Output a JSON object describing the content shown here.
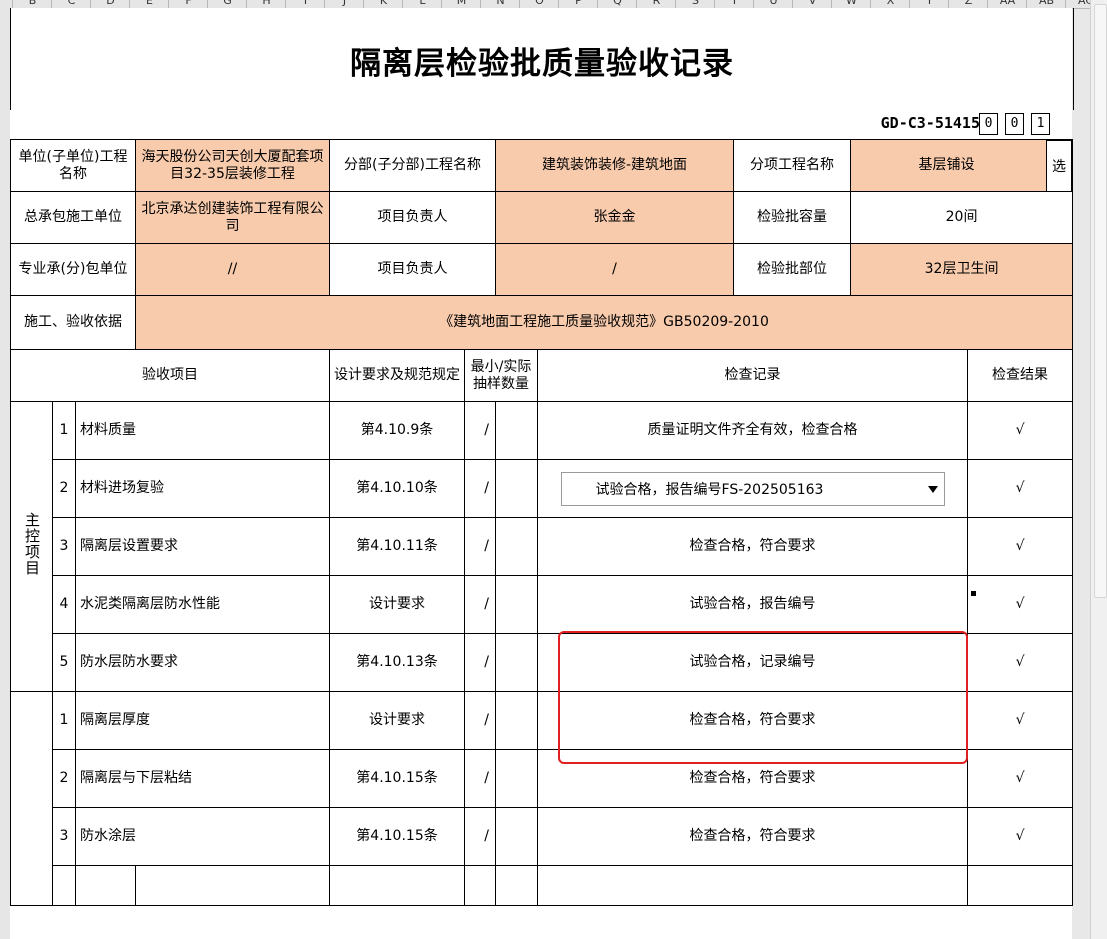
{
  "column_headers": [
    "B",
    "C",
    "D",
    "E",
    "F",
    "G",
    "H",
    "I",
    "J",
    "K",
    "L",
    "M",
    "N",
    "O",
    "P",
    "Q",
    "R",
    "S",
    "T",
    "U",
    "V",
    "W",
    "X",
    "Y",
    "Z",
    "AA",
    "AB",
    "AC"
  ],
  "title": "隔离层检验批质量验收记录",
  "doc_code": "GD-C3-51415",
  "code_digits": [
    "0",
    "0",
    "1"
  ],
  "header": {
    "unit_label": "单位(子单位)工程名称",
    "unit_value": "海天股份公司天创大厦配套项目32-35层装修工程",
    "division_label": "分部(子分部)工程名称",
    "division_value": "建筑装饰装修-建筑地面",
    "subitem_label": "分项工程名称",
    "subitem_value": "基层铺设",
    "select_label": "选",
    "contractor_label": "总承包施工单位",
    "contractor_value": "北京承达创建装饰工程有限公司",
    "pm_label": "项目负责人",
    "pm_value": "张金金",
    "capacity_label": "检验批容量",
    "capacity_value": "20间",
    "sub_label": "专业承(分)包单位",
    "sub_value": "//",
    "pm2_label": "项目负责人",
    "pm2_value": "/",
    "location_label": "检验批部位",
    "location_value": "32层卫生间",
    "basis_label": "施工、验收依据",
    "basis_value": "《建筑地面工程施工质量验收规范》GB50209-2010"
  },
  "columns": {
    "item": "验收项目",
    "design": "设计要求及规范规定",
    "sampling": "最小/实际抽样数量",
    "record": "检查记录",
    "result": "检查结果"
  },
  "main_group_label": "主控项目",
  "main_items": [
    {
      "no": "1",
      "name": "材料质量",
      "spec": "第4.10.9条",
      "sample": "/",
      "record": "质量证明文件齐全有效，检查合格",
      "result": "√"
    },
    {
      "no": "2",
      "name": "材料进场复验",
      "spec": "第4.10.10条",
      "sample": "/",
      "record": "试验合格，报告编号FS-202505163",
      "result": "√"
    },
    {
      "no": "3",
      "name": "隔离层设置要求",
      "spec": "第4.10.11条",
      "sample": "/",
      "record": "检查合格，符合要求",
      "result": "√"
    },
    {
      "no": "4",
      "name": "水泥类隔离层防水性能",
      "spec": "设计要求",
      "sample": "/",
      "record": "试验合格，报告编号",
      "result": "√"
    },
    {
      "no": "5",
      "name": "防水层防水要求",
      "spec": "第4.10.13条",
      "sample": "/",
      "record": "试验合格，记录编号",
      "result": "√"
    }
  ],
  "general_items": [
    {
      "no": "1",
      "name": "隔离层厚度",
      "spec": "设计要求",
      "sample": "/",
      "record": "检查合格，符合要求",
      "result": "√"
    },
    {
      "no": "2",
      "name": "隔离层与下层粘结",
      "spec": "第4.10.15条",
      "sample": "/",
      "record": "检查合格，符合要求",
      "result": "√"
    },
    {
      "no": "3",
      "name": "防水涂层",
      "spec": "第4.10.15条",
      "sample": "/",
      "record": "检查合格，符合要求",
      "result": "√"
    }
  ],
  "colors": {
    "peach": "#f8cbad",
    "highlight": "#e02020"
  }
}
